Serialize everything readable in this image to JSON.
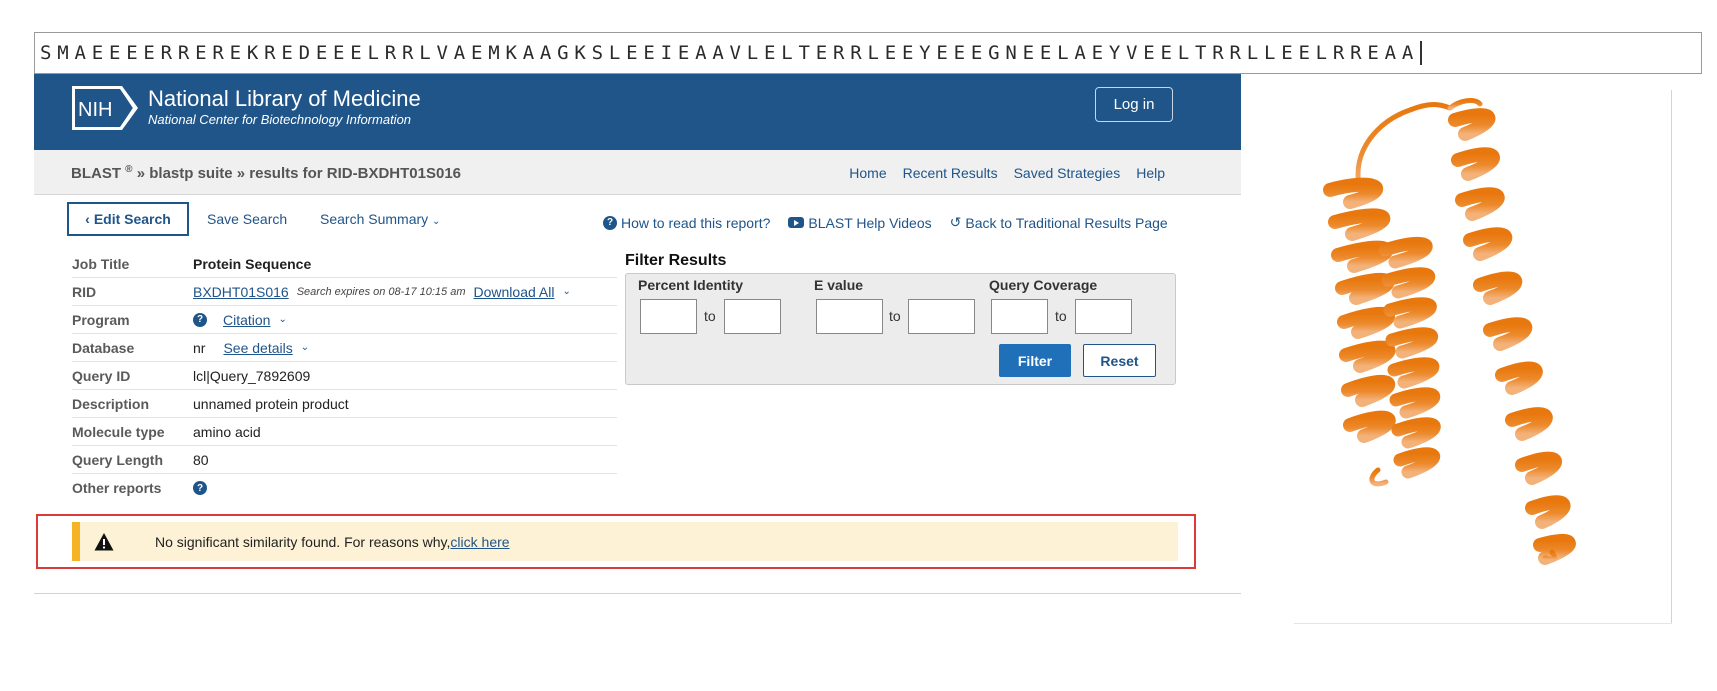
{
  "sequence": {
    "text": "SMAEEEERREREKREDEEELRRLVAEMKAAGKSLEEIEAAVLELTERRLEEYEEEGNEELAEYVEELTRRLLEELRREAA"
  },
  "header": {
    "logo_text": "NIH",
    "title": "National Library of Medicine",
    "subtitle": "National Center for Biotechnology Information",
    "login_label": "Log in",
    "bg_color": "#20558a"
  },
  "breadcrumb": {
    "blast": "BLAST",
    "reg": "®",
    "sep1": "»",
    "suite": "blastp suite",
    "sep2": "»",
    "results": "results for RID-BXDHT01S016"
  },
  "top_nav": [
    "Home",
    "Recent Results",
    "Saved Strategies",
    "Help"
  ],
  "toolbar": {
    "edit_search": "Edit Search",
    "save_search": "Save Search",
    "search_summary": "Search Summary",
    "how_to_read": "How to read this report?",
    "help_videos": "BLAST Help Videos",
    "back_traditional": "Back to Traditional Results Page"
  },
  "info": {
    "job_title_label": "Job Title",
    "job_title": "Protein Sequence",
    "rid_label": "RID",
    "rid": "BXDHT01S016",
    "rid_expires": "Search expires on 08-17 10:15 am",
    "download_all": "Download All",
    "program_label": "Program",
    "citation": "Citation",
    "database_label": "Database",
    "database": "nr",
    "see_details": "See details",
    "query_id_label": "Query ID",
    "query_id": "lcl|Query_7892609",
    "description_label": "Description",
    "description": "unnamed protein product",
    "molecule_type_label": "Molecule type",
    "molecule_type": "amino acid",
    "query_length_label": "Query Length",
    "query_length": "80",
    "other_reports_label": "Other reports"
  },
  "filter": {
    "title": "Filter Results",
    "percent_identity": "Percent Identity",
    "e_value": "E value",
    "query_coverage": "Query Coverage",
    "to": "to",
    "filter_btn": "Filter",
    "reset_btn": "Reset"
  },
  "alert": {
    "message": "No significant similarity found. For reasons why,",
    "link": "click here"
  },
  "colors": {
    "primary": "#20558a",
    "filter_button": "#1f6fb9",
    "alert_bg": "#fdf2d6",
    "alert_bar": "#f5b325",
    "alert_outline": "#d93a3a",
    "protein": "#e8780e"
  }
}
